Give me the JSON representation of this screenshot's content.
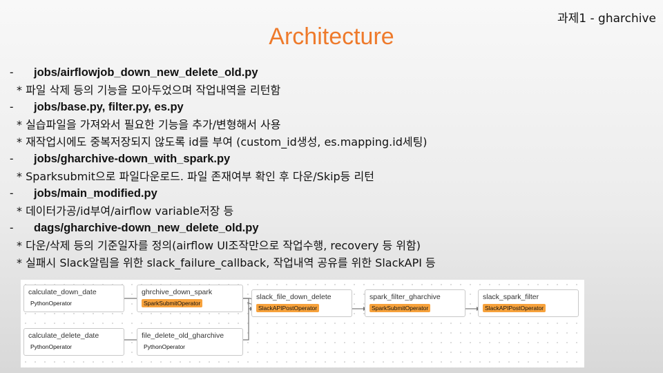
{
  "corner_label": "과제1 - gharchive",
  "title": "Architecture",
  "sections": [
    {
      "dash": "-",
      "job": "jobs/airflowjob_down_new_delete_old.py",
      "notes": [
        "* 파일 삭제 등의 기능을 모아두었으며 작업내역을 리턴함"
      ]
    },
    {
      "dash": "-",
      "job": "jobs/base.py, filter.py, es.py",
      "notes": [
        "* 실습파일을 가져와서 필요한 기능을 추가/변형해서 사용",
        "* 재작업시에도 중복저장되지 않도록 id를 부여 (custom_id생성, es.mapping.id세팅)"
      ]
    },
    {
      "dash": "-",
      "job": "jobs/gharchive-down_with_spark.py",
      "notes": [
        "* Sparksubmit으로 파일다운로드. 파일 존재여부 확인 후 다운/Skip등 리턴"
      ]
    },
    {
      "dash": "-",
      "job": "jobs/main_modified.py",
      "notes": [
        "* 데이터가공/id부여/airflow variable저장 등"
      ]
    },
    {
      "dash": "-",
      "job": "dags/gharchive-down_new_delete_old.py",
      "notes": [
        "* 다운/삭제 등의 기준일자를 정의(airflow UI조작만으로 작업수행, recovery 등 위함)",
        "* 실패시 Slack알림을 위한 slack_failure_callback, 작업내역 공유를 위한 SlackAPI 등"
      ]
    }
  ],
  "dag": {
    "nodes": [
      {
        "name": "calculate_down_date",
        "operator": "PythonOperator"
      },
      {
        "name": "ghrchive_down_spark",
        "operator": "SparkSubmitOperator"
      },
      {
        "name": "slack_file_down_delete",
        "operator": "SlackAPIPostOperator"
      },
      {
        "name": "spark_filter_gharchive",
        "operator": "SparkSubmitOperator"
      },
      {
        "name": "slack_spark_filter",
        "operator": "SlackAPIPostOperator"
      },
      {
        "name": "calculate_delete_date",
        "operator": "PythonOperator"
      },
      {
        "name": "file_delete_old_gharchive",
        "operator": "PythonOperator"
      }
    ],
    "operator_colors": {
      "PythonOperator": "#ffffff",
      "SparkSubmitOperator": "#f7a23c",
      "SlackAPIPostOperator": "#f7a23c"
    }
  },
  "colors": {
    "title": "#ee7a2b"
  }
}
